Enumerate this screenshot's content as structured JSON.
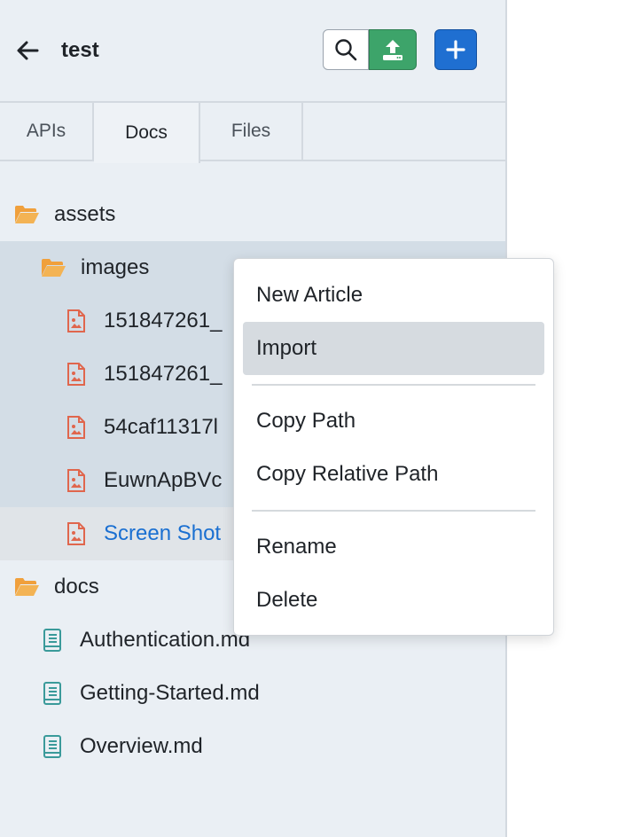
{
  "header": {
    "title": "test",
    "back_icon": "arrow-left-icon",
    "search_icon": "search-icon",
    "upload_icon": "upload-icon",
    "add_icon": "plus-icon"
  },
  "tabs": [
    {
      "label": "APIs",
      "active": false
    },
    {
      "label": "Docs",
      "active": true
    },
    {
      "label": "Files",
      "active": false
    }
  ],
  "tree": {
    "assets": {
      "label": "assets",
      "icon": "folder-open-icon"
    },
    "images": {
      "label": "images",
      "icon": "folder-open-icon"
    },
    "image_files": [
      {
        "label": "151847261_",
        "icon": "image-file-icon"
      },
      {
        "label": "151847261_",
        "icon": "image-file-icon"
      },
      {
        "label": "54caf11317l",
        "icon": "image-file-icon"
      },
      {
        "label": "EuwnApBVc",
        "icon": "image-file-icon"
      },
      {
        "label": "Screen Shot",
        "icon": "image-file-icon"
      }
    ],
    "docs": {
      "label": "docs",
      "icon": "folder-open-icon"
    },
    "doc_files": [
      {
        "label": "Authentication.md",
        "icon": "document-icon"
      },
      {
        "label": "Getting-Started.md",
        "icon": "document-icon"
      },
      {
        "label": "Overview.md",
        "icon": "document-icon"
      }
    ]
  },
  "context_menu": {
    "items": [
      "New Article",
      "Import",
      "Copy Path",
      "Copy Relative Path",
      "Rename",
      "Delete"
    ],
    "highlighted": "Import"
  },
  "colors": {
    "sidebar_bg": "#eaeff4",
    "selected_bg": "#d3dde6",
    "folder": "#f0a03c",
    "image_file": "#e0664d",
    "doc_file": "#3a9a9a",
    "upload_btn": "#3da46a",
    "add_btn": "#1f6fd1",
    "link": "#1a6fd1"
  }
}
